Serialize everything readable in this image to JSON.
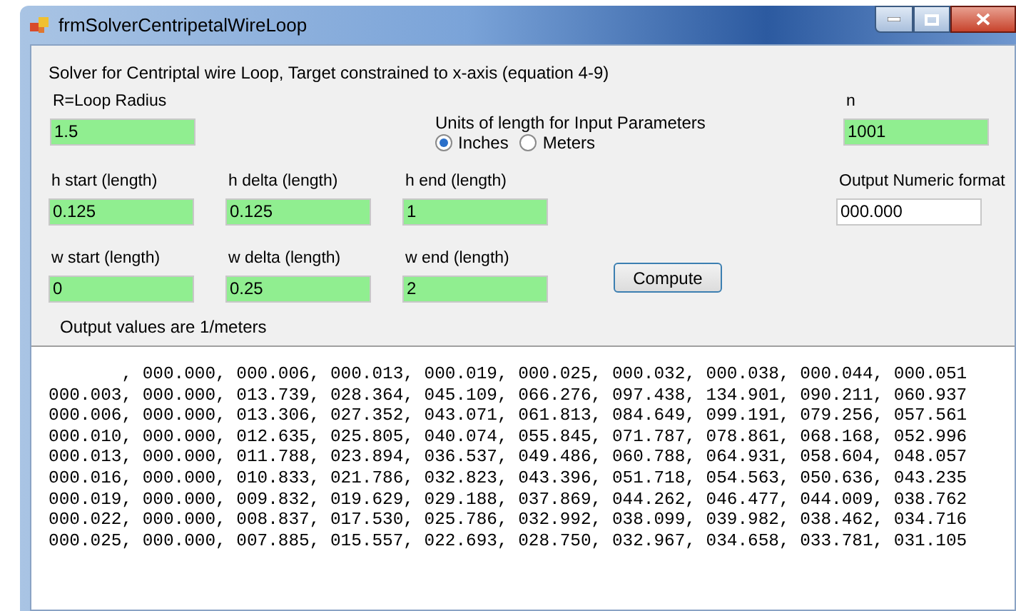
{
  "window": {
    "title": "frmSolverCentripetalWireLoop"
  },
  "description": "Solver for Centriptal wire Loop, Target constrained to x-axis (equation 4-9)",
  "radius": {
    "label": "R=Loop Radius",
    "value": "1.5",
    "highlighted": true
  },
  "units": {
    "label": "Units of length  for Input Parameters",
    "options": [
      {
        "label": "Inches",
        "selected": true
      },
      {
        "label": "Meters",
        "selected": false
      }
    ]
  },
  "n": {
    "label": "n",
    "value": "1001",
    "highlighted": true
  },
  "h_fields": [
    {
      "label": "h start (length)",
      "value": "0.125",
      "highlighted": true
    },
    {
      "label": "h delta (length)",
      "value": "0.125",
      "highlighted": true
    },
    {
      "label": "h end (length)",
      "value": "1",
      "highlighted": true
    }
  ],
  "output_format": {
    "label": "Output Numeric format",
    "value": "000.000",
    "highlighted": false
  },
  "w_fields": [
    {
      "label": "w start (length)",
      "value": "0",
      "highlighted": true
    },
    {
      "label": "w delta (length)",
      "value": "0.25",
      "highlighted": true
    },
    {
      "label": "w end (length)",
      "value": "2",
      "highlighted": true
    }
  ],
  "compute_button": "Compute",
  "output_note": "Output values are 1/meters",
  "output_lines": [
    "       , 000.000, 000.006, 000.013, 000.019, 000.025, 000.032, 000.038, 000.044, 000.051",
    "000.003, 000.000, 013.739, 028.364, 045.109, 066.276, 097.438, 134.901, 090.211, 060.937",
    "000.006, 000.000, 013.306, 027.352, 043.071, 061.813, 084.649, 099.191, 079.256, 057.561",
    "000.010, 000.000, 012.635, 025.805, 040.074, 055.845, 071.787, 078.861, 068.168, 052.996",
    "000.013, 000.000, 011.788, 023.894, 036.537, 049.486, 060.788, 064.931, 058.604, 048.057",
    "000.016, 000.000, 010.833, 021.786, 032.823, 043.396, 051.718, 054.563, 050.636, 043.235",
    "000.019, 000.000, 009.832, 019.629, 029.188, 037.869, 044.262, 046.477, 044.009, 038.762",
    "000.022, 000.000, 008.837, 017.530, 025.786, 032.992, 038.099, 039.982, 038.462, 034.716",
    "000.025, 000.000, 007.885, 015.557, 022.693, 028.750, 032.967, 034.658, 033.781, 031.105"
  ]
}
